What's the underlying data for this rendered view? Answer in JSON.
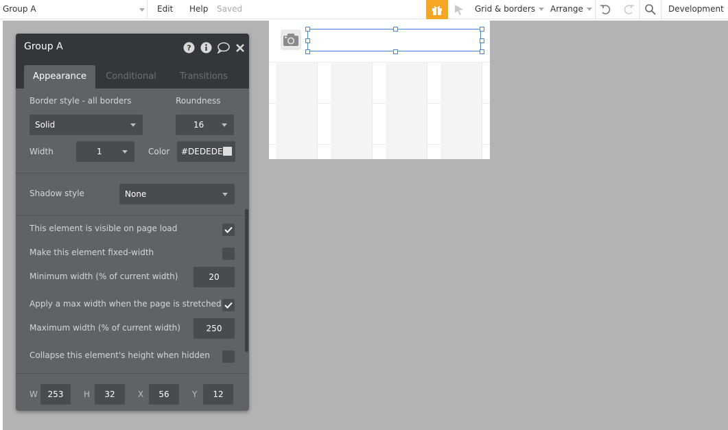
{
  "topbar": {
    "element_name": "Group A",
    "menu_edit": "Edit",
    "menu_help": "Help",
    "save_status": "Saved",
    "grid_borders": "Grid & borders",
    "arrange": "Arrange",
    "version": "Development",
    "gift_color": "#f5a623"
  },
  "panel": {
    "title": "Group A",
    "header_icons": [
      "help-icon",
      "info-icon",
      "comment-icon",
      "close-icon"
    ],
    "tabs": [
      {
        "label": "Appearance",
        "active": true
      },
      {
        "label": "Conditional",
        "active": false
      },
      {
        "label": "Transitions",
        "active": false
      }
    ],
    "border_style_label": "Border style - all borders",
    "roundness_label": "Roundness",
    "border_style_value": "Solid",
    "roundness_value": "16",
    "width_label": "Width",
    "width_value": "1",
    "color_label": "Color",
    "color_value": "#DEDEDE",
    "shadow_label": "Shadow style",
    "shadow_value": "None",
    "visible_label": "This element is visible on page load",
    "visible_checked": true,
    "fixed_width_label": "Make this element fixed-width",
    "fixed_width_checked": false,
    "min_width_label": "Minimum width (% of current width)",
    "min_width_value": "20",
    "max_width_apply_label": "Apply a max width when the page is stretched",
    "max_width_apply_checked": true,
    "max_width_label": "Maximum width (% of current width)",
    "max_width_value": "250",
    "collapse_label": "Collapse this element's height when hidden",
    "collapse_checked": false,
    "dims": {
      "w_label": "W",
      "w": "253",
      "h_label": "H",
      "h": "32",
      "x_label": "X",
      "x": "56",
      "y_label": "Y",
      "y": "12"
    }
  },
  "colors": {
    "panel_bg": "#5f6368",
    "panel_header": "#33373b",
    "selection": "#3b8ad9",
    "canvas_bg": "#b3b3b3"
  }
}
